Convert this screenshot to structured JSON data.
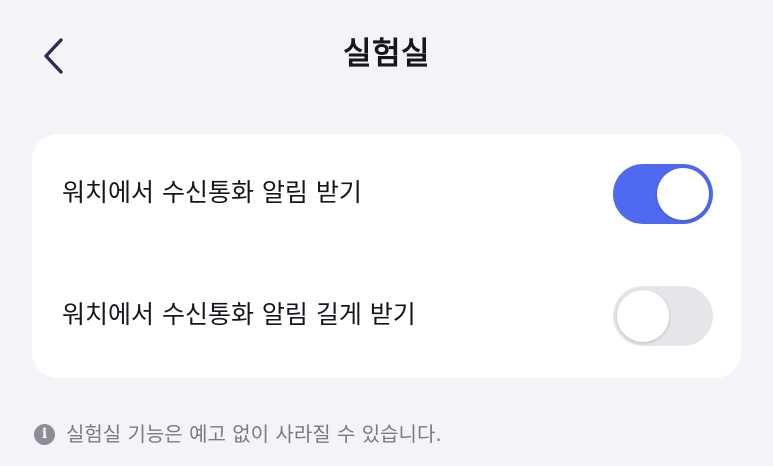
{
  "header": {
    "title": "실험실",
    "back_icon": "chevron-left-icon"
  },
  "settings": [
    {
      "label": "워치에서 수신통화 알림 받기",
      "enabled": true
    },
    {
      "label": "워치에서 수신통화 알림 길게 받기",
      "enabled": false
    }
  ],
  "footer": {
    "icon": "info-icon",
    "note": "실험실 기능은 예고 없이 사라질 수 있습니다."
  },
  "colors": {
    "background": "#f4f4f8",
    "card": "#ffffff",
    "toggle_on": "#4f6af0",
    "toggle_off": "#e6e6ea",
    "text_primary": "#16161d",
    "text_secondary": "#7a7a86"
  }
}
